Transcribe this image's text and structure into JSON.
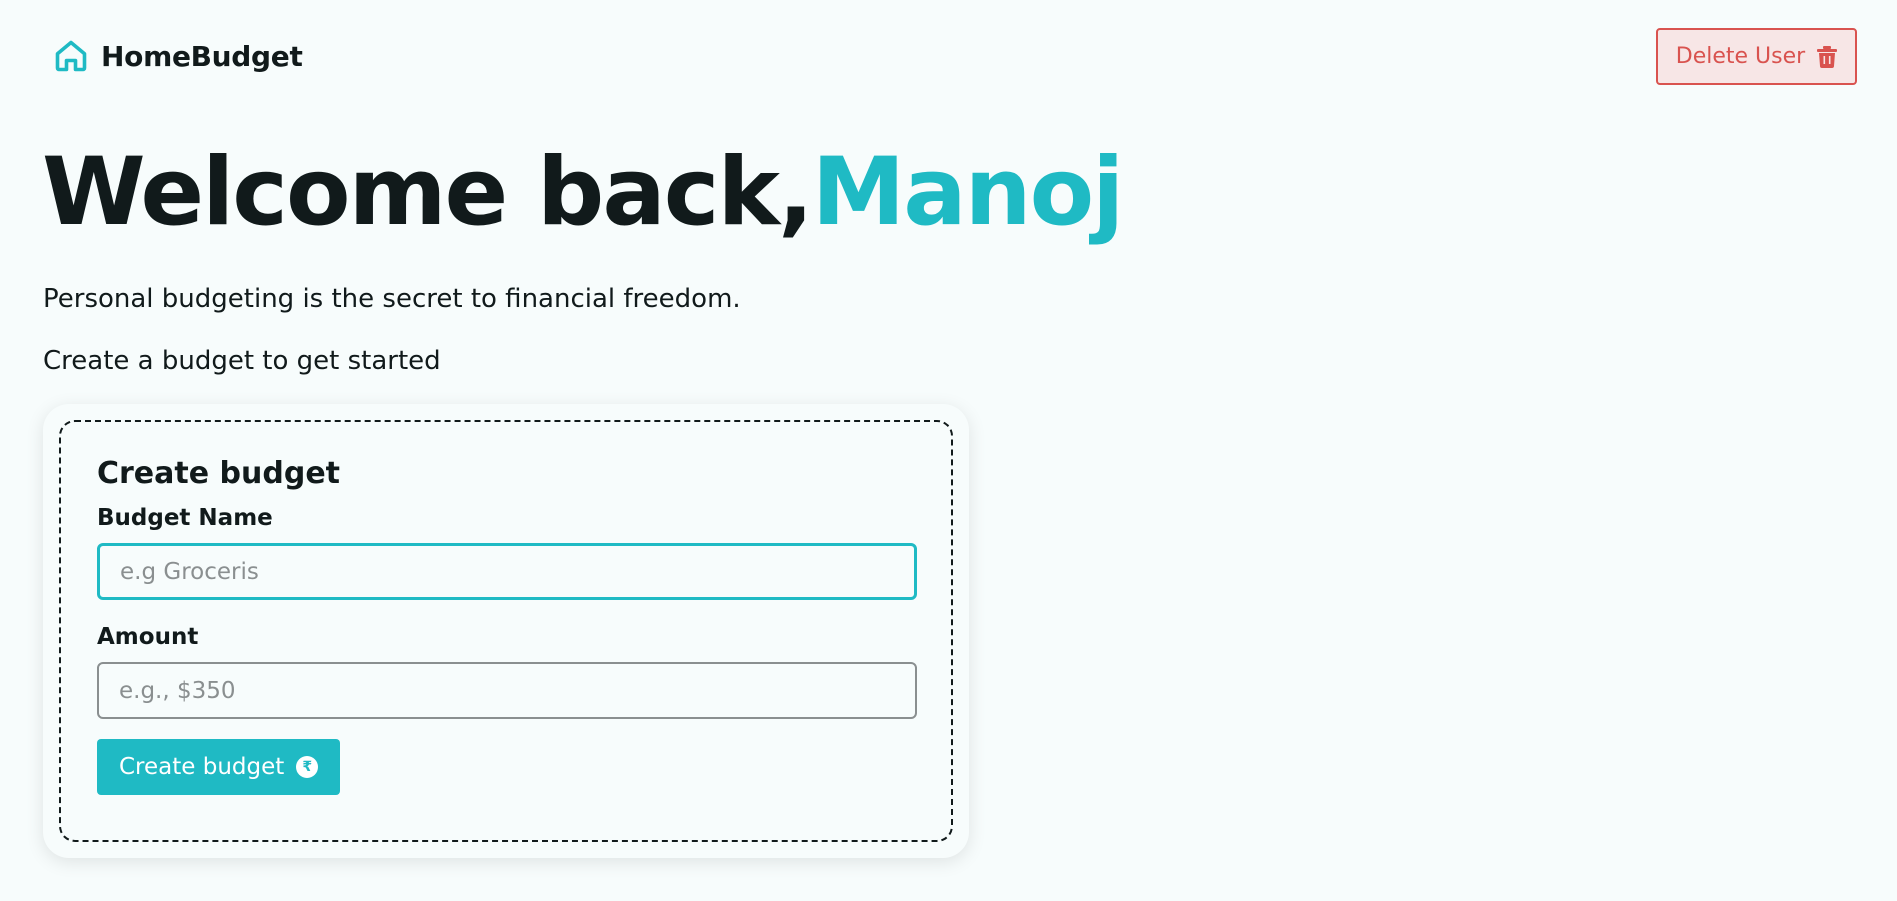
{
  "nav": {
    "brand": "HomeBudget",
    "brand_icon": "home-icon",
    "delete_label": "Delete User",
    "delete_icon": "trash-icon"
  },
  "hero": {
    "welcome_prefix": "Welcome back,",
    "user_name": "Manoj",
    "tagline": "Personal budgeting is the secret to financial freedom.",
    "cta": "Create a budget to get started"
  },
  "form": {
    "title": "Create budget",
    "name_label": "Budget Name",
    "name_placeholder": "e.g Groceris",
    "name_value": "",
    "amount_label": "Amount",
    "amount_placeholder": "e.g., $350",
    "amount_value": "",
    "submit_label": "Create budget",
    "submit_icon": "rupee-coin-icon",
    "submit_icon_glyph": "₹"
  },
  "colors": {
    "accent": "#1fbac4",
    "danger": "#d9534f",
    "background": "#f7fcfc",
    "text": "#111a1b"
  }
}
